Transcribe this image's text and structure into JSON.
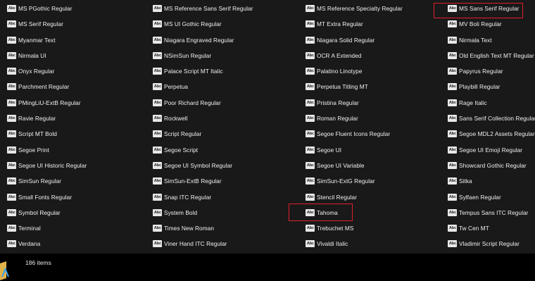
{
  "fonts": [
    [
      "MS PGothic Regular",
      "MS Reference Sans Serif Regular",
      "MS Reference Specialty Regular",
      "MS Sans Serif Regular"
    ],
    [
      "MS Serif Regular",
      "MS UI Gothic Regular",
      "MT Extra Regular",
      "MV Boli Regular"
    ],
    [
      "Myanmar Text",
      "Niagara Engraved Regular",
      "Niagara Solid Regular",
      "Nirmala Text"
    ],
    [
      "Nirmala UI",
      "NSimSun Regular",
      "OCR A Extended",
      "Old English Text MT Regular"
    ],
    [
      "Onyx Regular",
      "Palace Script MT Italic",
      "Palatino Linotype",
      "Papyrus Regular"
    ],
    [
      "Parchment Regular",
      "Perpetua",
      "Perpetua Titling MT",
      "Playbill Regular"
    ],
    [
      "PMingLiU-ExtB Regular",
      "Poor Richard Regular",
      "Pristina Regular",
      "Rage Italic"
    ],
    [
      "Ravie Regular",
      "Rockwell",
      "Roman Regular",
      "Sans Serif Collection Regular"
    ],
    [
      "Script MT Bold",
      "Script Regular",
      "Segoe Fluent Icons Regular",
      "Segoe MDL2 Assets Regular"
    ],
    [
      "Segoe Print",
      "Segoe Script",
      "Segoe UI",
      "Segoe UI Emoji Regular"
    ],
    [
      "Segoe UI Historic Regular",
      "Segoe UI Symbol Regular",
      "Segoe UI Variable",
      "Showcard Gothic Regular"
    ],
    [
      "SimSun Regular",
      "SimSun-ExtB Regular",
      "SimSun-ExtG Regular",
      "Sitka"
    ],
    [
      "Small Fonts Regular",
      "Snap ITC Regular",
      "Stencil Regular",
      "Sylfaen Regular"
    ],
    [
      "Symbol Regular",
      "System Bold",
      "Tahoma",
      "Tempus Sans ITC Regular"
    ],
    [
      "Terminal",
      "Times New Roman",
      "Trebuchet MS",
      "Tw Cen MT"
    ],
    [
      "Verdana",
      "Viner Hand ITC Regular",
      "Vivaldi Italic",
      "Vladimir Script Regular"
    ]
  ],
  "highlighted": [
    "MS Sans Serif Regular",
    "Tahoma"
  ],
  "status": {
    "item_count": "186 items"
  },
  "colors": {
    "background": "#191919",
    "highlight": "#e0212b",
    "statusbar": "#000000"
  },
  "icons": {
    "font_file": "font-file-icon",
    "taskbar": "folder-app-icon"
  }
}
